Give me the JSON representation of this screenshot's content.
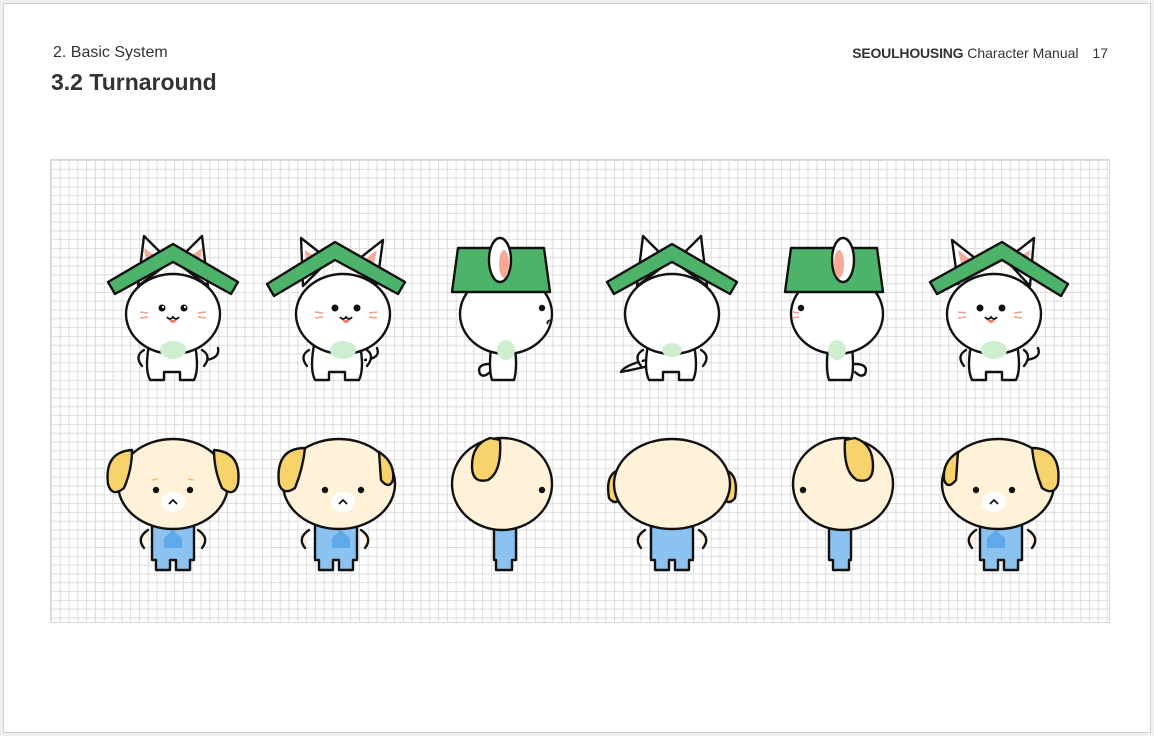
{
  "header": {
    "section": "2. Basic System",
    "title": "3.2 Turnaround",
    "brand": "SEOULHOUSING",
    "manual": "Character Manual",
    "page_number": "17"
  },
  "turnaround": {
    "rows": [
      {
        "character": "cat-house-character",
        "views": [
          "front",
          "three-quarter-left",
          "side-left",
          "back",
          "side-right",
          "three-quarter-right"
        ],
        "colors": {
          "roof": "#4db36a",
          "inner_ear": "#f5a996",
          "belly": "#cdeecf",
          "outline": "#111111",
          "body": "#ffffff"
        }
      },
      {
        "character": "dog-character",
        "views": [
          "front",
          "three-quarter-left",
          "side-left",
          "back",
          "side-right",
          "three-quarter-right"
        ],
        "colors": {
          "head": "#fff2d9",
          "ear": "#f8d26a",
          "overalls": "#8cc2f0",
          "house_patch": "#5fa8ea",
          "outline": "#111111"
        }
      }
    ]
  }
}
